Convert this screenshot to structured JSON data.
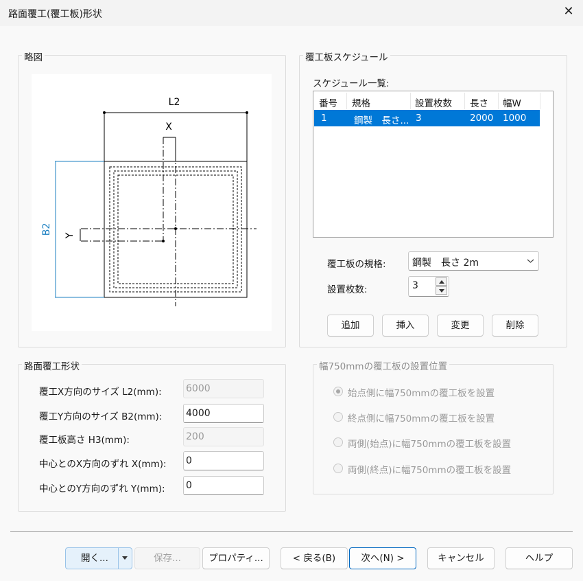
{
  "window": {
    "title": "路面覆工(覆工板)形状"
  },
  "diagram_group": {
    "title": "略図",
    "labels": {
      "l2": "L2",
      "x": "X",
      "b2": "B2",
      "y": "Y"
    }
  },
  "shape_group": {
    "title": "路面覆工形状",
    "fields": [
      {
        "label": "覆工X方向のサイズ L2(mm):",
        "value": "6000",
        "enabled": false
      },
      {
        "label": "覆工Y方向のサイズ B2(mm):",
        "value": "4000",
        "enabled": true
      },
      {
        "label": "覆工板高さ H3(mm):",
        "value": "200",
        "enabled": false
      },
      {
        "label": "中心とのX方向のずれ X(mm):",
        "value": "0",
        "enabled": true
      },
      {
        "label": "中心とのY方向のずれ Y(mm):",
        "value": "0",
        "enabled": true
      }
    ]
  },
  "schedule_group": {
    "title": "覆工板スケジュール",
    "list_label": "スケジュール一覧:",
    "columns": [
      "番号",
      "規格",
      "設置枚数",
      "長さ",
      "幅W"
    ],
    "rows": [
      [
        "1",
        "鋼製　長さ...",
        "3",
        "2000",
        "1000"
      ]
    ],
    "spec_label": "覆工板の規格:",
    "spec_value": "鋼製　長さ 2m",
    "count_label": "設置枚数:",
    "count_value": "3",
    "buttons": {
      "add": "追加",
      "insert": "挿入",
      "change": "変更",
      "delete": "削除"
    }
  },
  "position_group": {
    "title": "幅750mmの覆工板の設置位置",
    "options": [
      {
        "label": "始点側に幅750mmの覆工板を設置",
        "selected": true
      },
      {
        "label": "終点側に幅750mmの覆工板を設置",
        "selected": false
      },
      {
        "label": "両側(始点)に幅750mmの覆工板を設置",
        "selected": false
      },
      {
        "label": "両側(終点)に幅750mmの覆工板を設置",
        "selected": false
      }
    ]
  },
  "footer": {
    "open": "開く...",
    "save": "保存...",
    "properties": "プロパティ...",
    "back": "< 戻る(B)",
    "next": "次へ(N) >",
    "cancel": "キャンセル",
    "help": "ヘルプ"
  },
  "colors": {
    "accent": "#0078d7",
    "dimension_blue": "#1b7fc1"
  }
}
